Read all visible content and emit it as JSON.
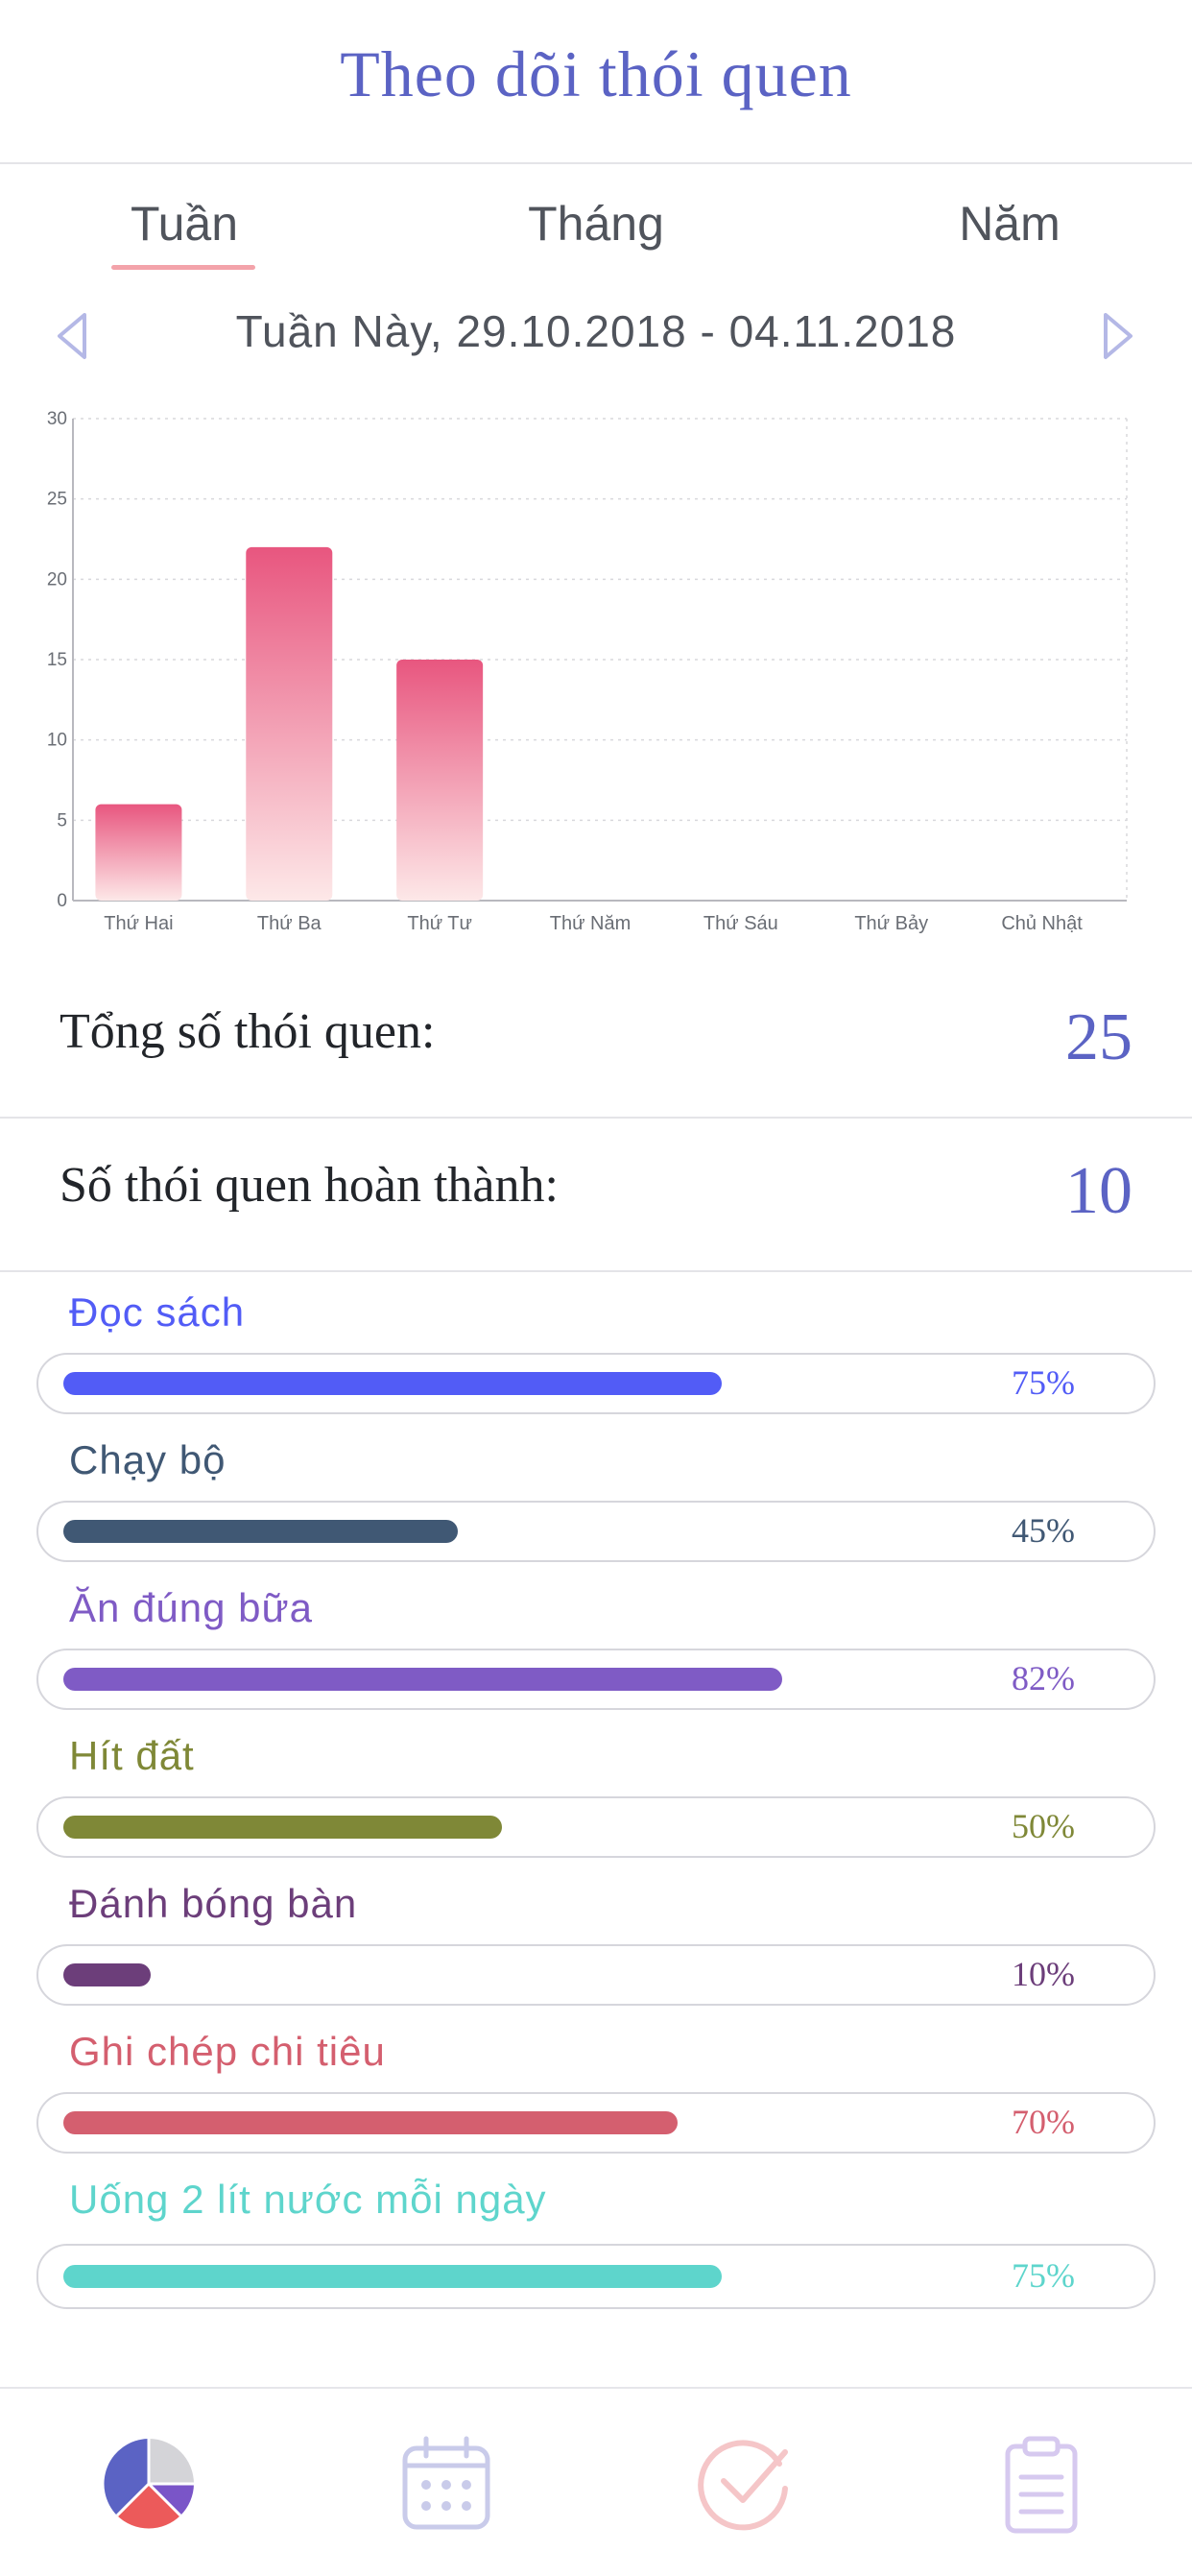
{
  "header": {
    "title": "Theo dõi thói quen"
  },
  "tabs": [
    {
      "label": "Tuần",
      "active": true
    },
    {
      "label": "Tháng",
      "active": false
    },
    {
      "label": "Năm",
      "active": false
    }
  ],
  "range": {
    "label": "Tuần Này, 29.10.2018 - 04.11.2018"
  },
  "chart_data": {
    "type": "bar",
    "categories": [
      "Thứ Hai",
      "Thứ Ba",
      "Thứ Tư",
      "Thứ Năm",
      "Thứ Sáu",
      "Thứ Bảy",
      "Chủ Nhật"
    ],
    "values": [
      6,
      22,
      15,
      0,
      0,
      0,
      0
    ],
    "title": "",
    "xlabel": "",
    "ylabel": "",
    "ylim": [
      0,
      30
    ],
    "yticks": [
      0,
      5,
      10,
      15,
      20,
      25,
      30
    ],
    "grid": true,
    "bar_gradient": [
      "#e8567f",
      "#fde8e8"
    ]
  },
  "stats": {
    "total_label": "Tổng số thói quen:",
    "total_value": "25",
    "done_label": "Số thói quen hoàn thành:",
    "done_value": "10"
  },
  "habits": [
    {
      "name": "Đọc sách",
      "percent_label": "75%",
      "progress": 0.75,
      "color": "#525cf6"
    },
    {
      "name": "Chạy bộ",
      "percent_label": "45%",
      "progress": 0.45,
      "color": "#405874"
    },
    {
      "name": "Ăn đúng bữa",
      "percent_label": "82%",
      "progress": 0.82,
      "color": "#7f5bc5"
    },
    {
      "name": "Hít đất",
      "percent_label": "50%",
      "progress": 0.5,
      "color": "#7f8837"
    },
    {
      "name": "Đánh bóng bàn",
      "percent_label": "10%",
      "progress": 0.1,
      "color": "#6c3e7a"
    },
    {
      "name": "Ghi chép chi tiêu",
      "percent_label": "70%",
      "progress": 0.7,
      "color": "#d45f6f"
    },
    {
      "name": "Uống 2 lít nước mỗi ngày",
      "percent_label": "75%",
      "progress": 0.75,
      "color": "#5ed5cc"
    }
  ],
  "bottom_nav": [
    {
      "icon": "pie-chart-icon",
      "active": true
    },
    {
      "icon": "calendar-icon",
      "active": false
    },
    {
      "icon": "check-circle-icon",
      "active": false
    },
    {
      "icon": "clipboard-list-icon",
      "active": false
    }
  ],
  "colors": {
    "accent": "#5b63c4",
    "tab_underline": "#f3a3aa",
    "arrow": "#b4b8e6"
  }
}
